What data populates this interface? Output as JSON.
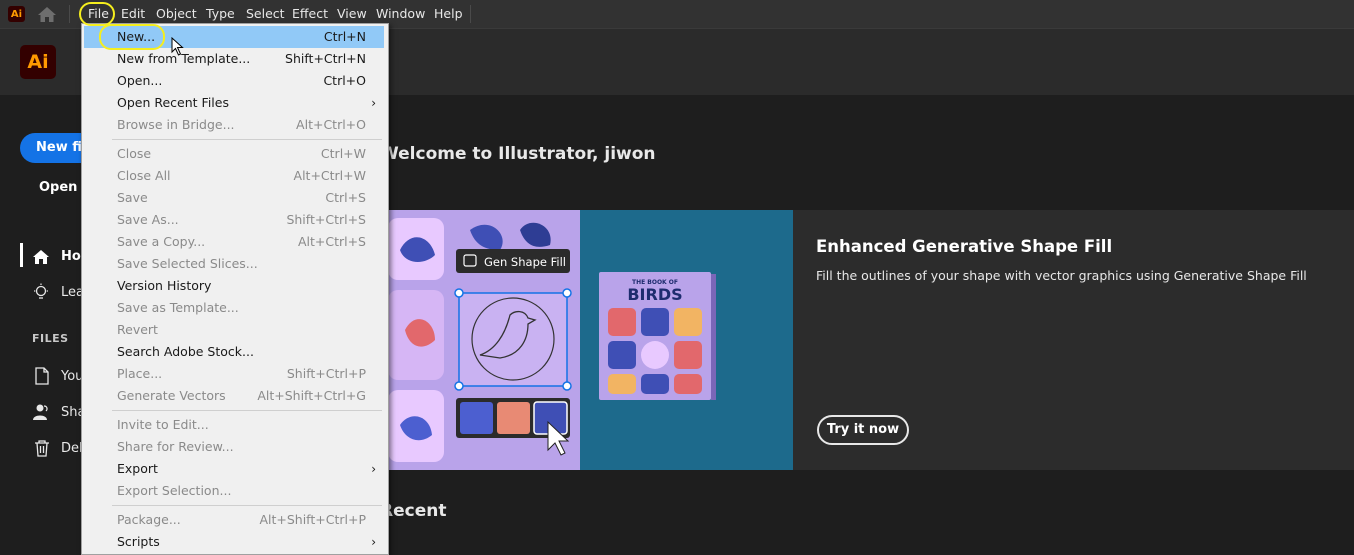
{
  "menubar": {
    "app_icon": "Ai",
    "items": [
      "File",
      "Edit",
      "Object",
      "Type",
      "Select",
      "Effect",
      "View",
      "Window",
      "Help"
    ]
  },
  "header": {
    "logo": "Ai"
  },
  "sidebar": {
    "new_file": "New file",
    "open": "Open",
    "nav": [
      {
        "label": "Home",
        "icon": "home-icon"
      },
      {
        "label": "Learn",
        "icon": "lightbulb-icon"
      }
    ],
    "files_heading": "FILES",
    "files": [
      {
        "label": "Your files",
        "icon": "document-icon"
      },
      {
        "label": "Shared with you",
        "icon": "user-icon"
      },
      {
        "label": "Deleted",
        "icon": "trash-icon"
      }
    ]
  },
  "main": {
    "welcome": "Welcome to Illustrator, jiwon",
    "banner": {
      "title": "Enhanced Generative Shape Fill",
      "description": "Fill the outlines of your shape with vector graphics using Generative Shape Fill",
      "button": "Try it now",
      "art_chip": "Gen Shape Fill",
      "book_title_1": "THE BOOK OF",
      "book_title_2": "BIRDS"
    },
    "recent": "Recent"
  },
  "file_menu": [
    {
      "label": "New...",
      "shortcut": "Ctrl+N",
      "enabled": true,
      "highlighted": true
    },
    {
      "label": "New from Template...",
      "shortcut": "Shift+Ctrl+N",
      "enabled": true
    },
    {
      "label": "Open...",
      "shortcut": "Ctrl+O",
      "enabled": true
    },
    {
      "label": "Open Recent Files",
      "shortcut": "",
      "enabled": true,
      "submenu": true
    },
    {
      "label": "Browse in Bridge...",
      "shortcut": "Alt+Ctrl+O",
      "enabled": false
    },
    {
      "separator": true
    },
    {
      "label": "Close",
      "shortcut": "Ctrl+W",
      "enabled": false
    },
    {
      "label": "Close All",
      "shortcut": "Alt+Ctrl+W",
      "enabled": false
    },
    {
      "label": "Save",
      "shortcut": "Ctrl+S",
      "enabled": false
    },
    {
      "label": "Save As...",
      "shortcut": "Shift+Ctrl+S",
      "enabled": false
    },
    {
      "label": "Save a Copy...",
      "shortcut": "Alt+Ctrl+S",
      "enabled": false
    },
    {
      "label": "Save Selected Slices...",
      "shortcut": "",
      "enabled": false
    },
    {
      "label": "Version History",
      "shortcut": "",
      "enabled": true
    },
    {
      "label": "Save as Template...",
      "shortcut": "",
      "enabled": false
    },
    {
      "label": "Revert",
      "shortcut": "",
      "enabled": false
    },
    {
      "label": "Search Adobe Stock...",
      "shortcut": "",
      "enabled": true
    },
    {
      "label": "Place...",
      "shortcut": "Shift+Ctrl+P",
      "enabled": false
    },
    {
      "label": "Generate Vectors",
      "shortcut": "Alt+Shift+Ctrl+G",
      "enabled": false
    },
    {
      "separator": true
    },
    {
      "label": "Invite to Edit...",
      "shortcut": "",
      "enabled": false
    },
    {
      "label": "Share for Review...",
      "shortcut": "",
      "enabled": false
    },
    {
      "label": "Export",
      "shortcut": "",
      "enabled": true,
      "submenu": true
    },
    {
      "label": "Export Selection...",
      "shortcut": "",
      "enabled": false
    },
    {
      "separator": true
    },
    {
      "label": "Package...",
      "shortcut": "Alt+Shift+Ctrl+P",
      "enabled": false
    },
    {
      "label": "Scripts",
      "shortcut": "",
      "enabled": true,
      "submenu": true
    }
  ],
  "colors": {
    "accent": "#1473e6",
    "menu_highlight": "#91c9f7",
    "annotation": "#f5ee1e",
    "logo_bg": "#330000",
    "logo_fg": "#ff9a00"
  }
}
